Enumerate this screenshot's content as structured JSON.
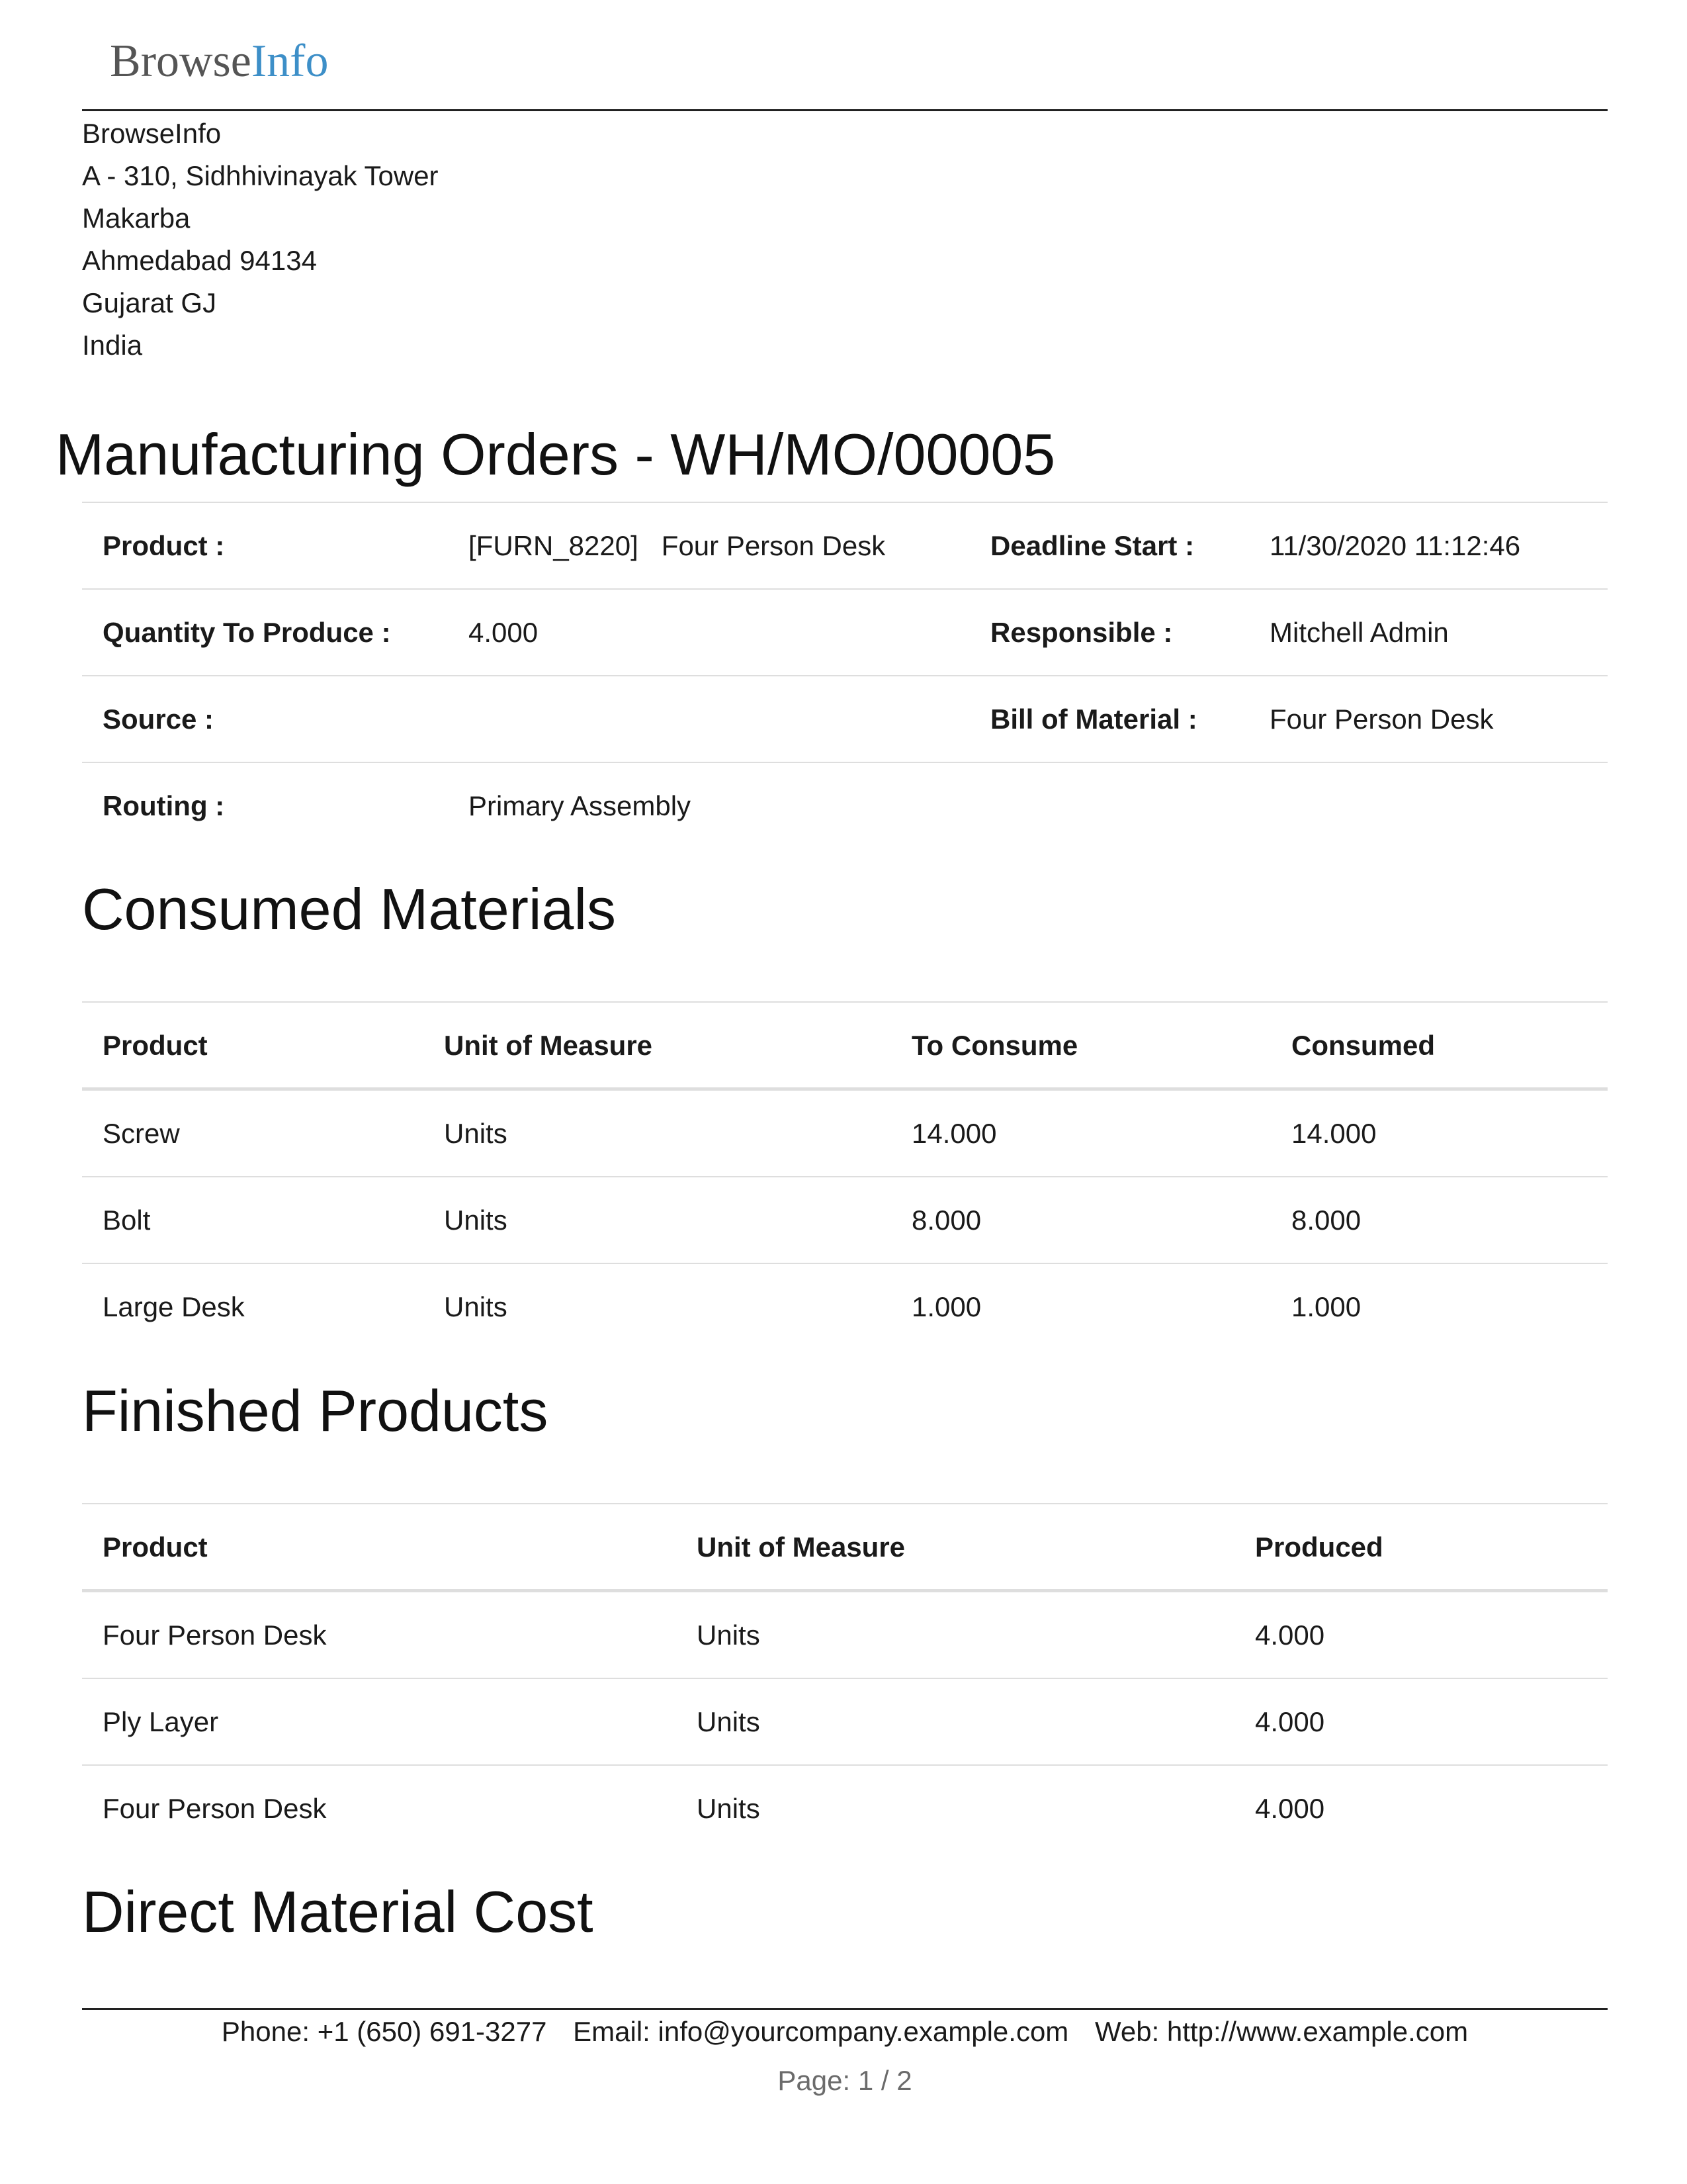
{
  "header": {
    "logo_part1": "Browse",
    "logo_part2": "Info",
    "address_lines": [
      "BrowseInfo",
      "A - 310, Sidhhivinayak Tower",
      "Makarba",
      "Ahmedabad 94134",
      "Gujarat GJ",
      "India"
    ]
  },
  "title": "Manufacturing Orders - WH/MO/00005",
  "info": {
    "product_label": "Product :",
    "product_value": "[FURN_8220]   Four Person Desk",
    "deadline_label": "Deadline Start :",
    "deadline_value": "11/30/2020 11:12:46",
    "quantity_label": "Quantity To Produce :",
    "quantity_value": "4.000",
    "responsible_label": "Responsible :",
    "responsible_value": "Mitchell Admin",
    "source_label": "Source :",
    "source_value": "",
    "bom_label": "Bill of Material :",
    "bom_value": "Four Person Desk",
    "routing_label": "Routing :",
    "routing_value": "Primary Assembly"
  },
  "consumed": {
    "title": "Consumed Materials",
    "headers": [
      "Product",
      "Unit of Measure",
      "To Consume",
      "Consumed"
    ],
    "rows": [
      [
        "Screw",
        "Units",
        "14.000",
        "14.000"
      ],
      [
        "Bolt",
        "Units",
        "8.000",
        "8.000"
      ],
      [
        "Large Desk",
        "Units",
        "1.000",
        "1.000"
      ]
    ]
  },
  "finished": {
    "title": "Finished Products",
    "headers": [
      "Product",
      "Unit of Measure",
      "Produced"
    ],
    "rows": [
      [
        "Four Person Desk",
        "Units",
        "4.000"
      ],
      [
        "Ply Layer",
        "Units",
        "4.000"
      ],
      [
        "Four Person Desk",
        "Units",
        "4.000"
      ]
    ]
  },
  "direct_cost": {
    "title": "Direct Material Cost"
  },
  "footer": {
    "phone": "Phone: +1 (650) 691-3277",
    "email": "Email: info@yourcompany.example.com",
    "web": "Web: http://www.example.com",
    "page": "Page: 1 / 2"
  },
  "colors": {
    "logo_accent": "#3d8fc8",
    "logo_gray": "#555555",
    "rule": "#dedede",
    "page_number": "#6b6b6b"
  }
}
